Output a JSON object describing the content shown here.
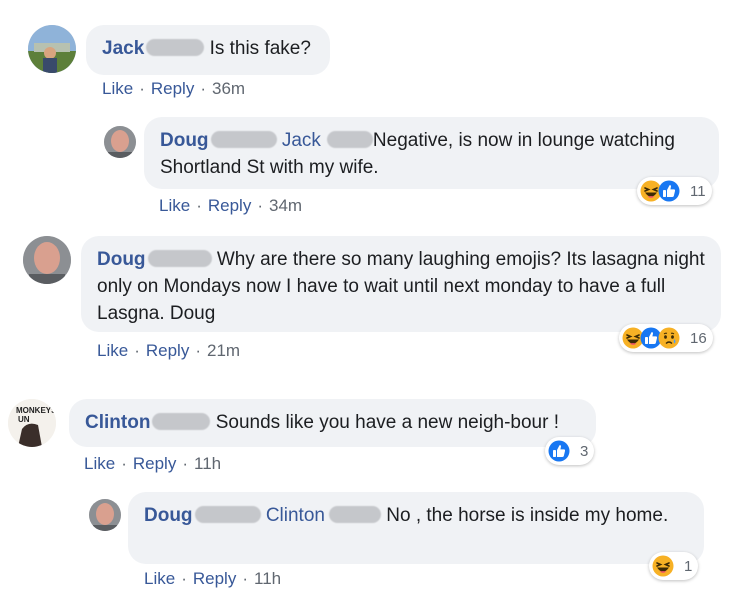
{
  "comments": [
    {
      "author": "Jack",
      "text": "Is this fake?",
      "actions": {
        "like": "Like",
        "reply": "Reply",
        "time": "36m"
      }
    },
    {
      "author": "Doug",
      "mention": "Jack",
      "text": "Negative, is now in lounge watching Shortland St with my wife.",
      "actions": {
        "like": "Like",
        "reply": "Reply",
        "time": "34m"
      },
      "reactions": {
        "icons": [
          "haha-icon",
          "like-icon"
        ],
        "count": "11"
      }
    },
    {
      "author": "Doug",
      "text": "Why are there so many laughing emojis? Its lasagna night only on Mondays now I have to wait until next monday to have a full Lasgna. Doug",
      "actions": {
        "like": "Like",
        "reply": "Reply",
        "time": "21m"
      },
      "reactions": {
        "icons": [
          "haha-icon",
          "like-icon",
          "sad-icon"
        ],
        "count": "16"
      }
    },
    {
      "author": "Clinton",
      "text": "Sounds like you have a new neigh-bour !",
      "avatar_sign": "MONKEYS UN",
      "actions": {
        "like": "Like",
        "reply": "Reply",
        "time": "11h"
      },
      "reactions": {
        "icons": [
          "like-icon"
        ],
        "count": "3"
      }
    },
    {
      "author": "Doug",
      "mention": "Clinton",
      "text": "No , the horse is inside my home.",
      "actions": {
        "like": "Like",
        "reply": "Reply",
        "time": "11h"
      },
      "reactions": {
        "icons": [
          "haha-icon"
        ],
        "count": "1"
      }
    }
  ],
  "colors": {
    "link": "#385898",
    "bubble": "#f0f2f5",
    "meta": "#606770",
    "like_blue": "#1877f2",
    "haha_yellow": "#f7b125"
  }
}
